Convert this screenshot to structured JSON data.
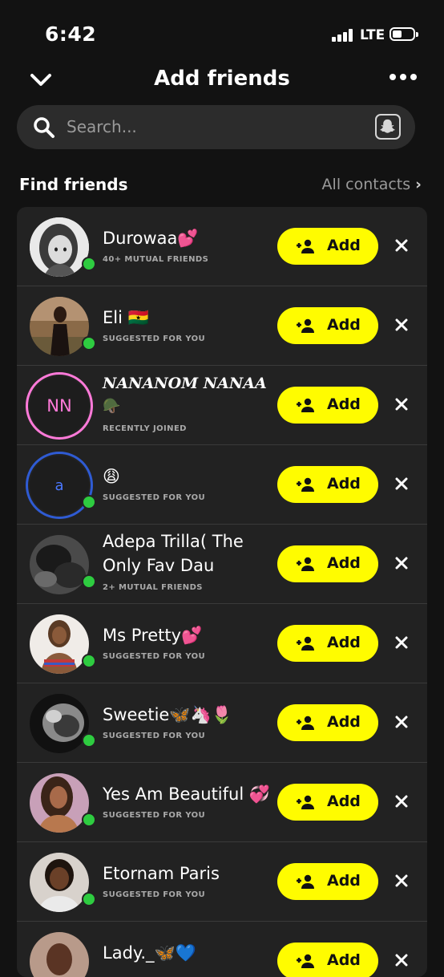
{
  "status_bar": {
    "time": "6:42",
    "network": "LTE",
    "battery_icon": "battery-icon",
    "signal_icon": "signal-icon"
  },
  "header": {
    "title": "Add friends",
    "back_icon": "chevron-down-icon",
    "more_icon": "more-icon"
  },
  "search": {
    "placeholder": "Search...",
    "scan_icon": "snapcode-icon"
  },
  "find_friends": {
    "title": "Find friends",
    "all_contacts": "All contacts"
  },
  "add_label": "Add",
  "friends": [
    {
      "name": "Durowaa💕",
      "subtitle": "40+ MUTUAL FRIENDS",
      "avatar": "bitmoji",
      "online": true
    },
    {
      "name": "Eli 🇬🇭",
      "subtitle": "SUGGESTED FOR YOU",
      "avatar": "photo",
      "online": true
    },
    {
      "name": "𝑵𝑨𝑵𝑨𝑵𝑶𝑴 𝑵𝑨𝑵𝑨𝑨",
      "name_extra": "🪖",
      "subtitle": "RECENTLY JOINED",
      "avatar": "initials",
      "initials": "NN",
      "online": false
    },
    {
      "name": "😩",
      "subtitle": "SUGGESTED FOR YOU",
      "avatar": "initials",
      "initials": "a",
      "online": true
    },
    {
      "name": "Adepa Trilla( The",
      "name_line2": "Only Fav Dau",
      "subtitle": "2+ MUTUAL FRIENDS",
      "avatar": "photo",
      "online": true
    },
    {
      "name": "Ms Pretty💕",
      "subtitle": "SUGGESTED FOR YOU",
      "avatar": "photo",
      "online": true
    },
    {
      "name": "Sweetie🦋🦄🌷",
      "subtitle": "SUGGESTED FOR YOU",
      "avatar": "photo",
      "online": true
    },
    {
      "name": "Yes Am Beautiful 💞",
      "subtitle": "SUGGESTED FOR YOU",
      "avatar": "photo",
      "online": true
    },
    {
      "name": "Etornam Paris",
      "subtitle": "SUGGESTED FOR YOU",
      "avatar": "photo",
      "online": true
    },
    {
      "name": "Lady._🦋💙",
      "subtitle": "",
      "avatar": "photo",
      "online": true
    }
  ],
  "colors": {
    "add_button": "#fffc00",
    "online": "#2ecc40",
    "nn_ring": "#ff7ad9",
    "a_ring": "#2f5bd3"
  }
}
